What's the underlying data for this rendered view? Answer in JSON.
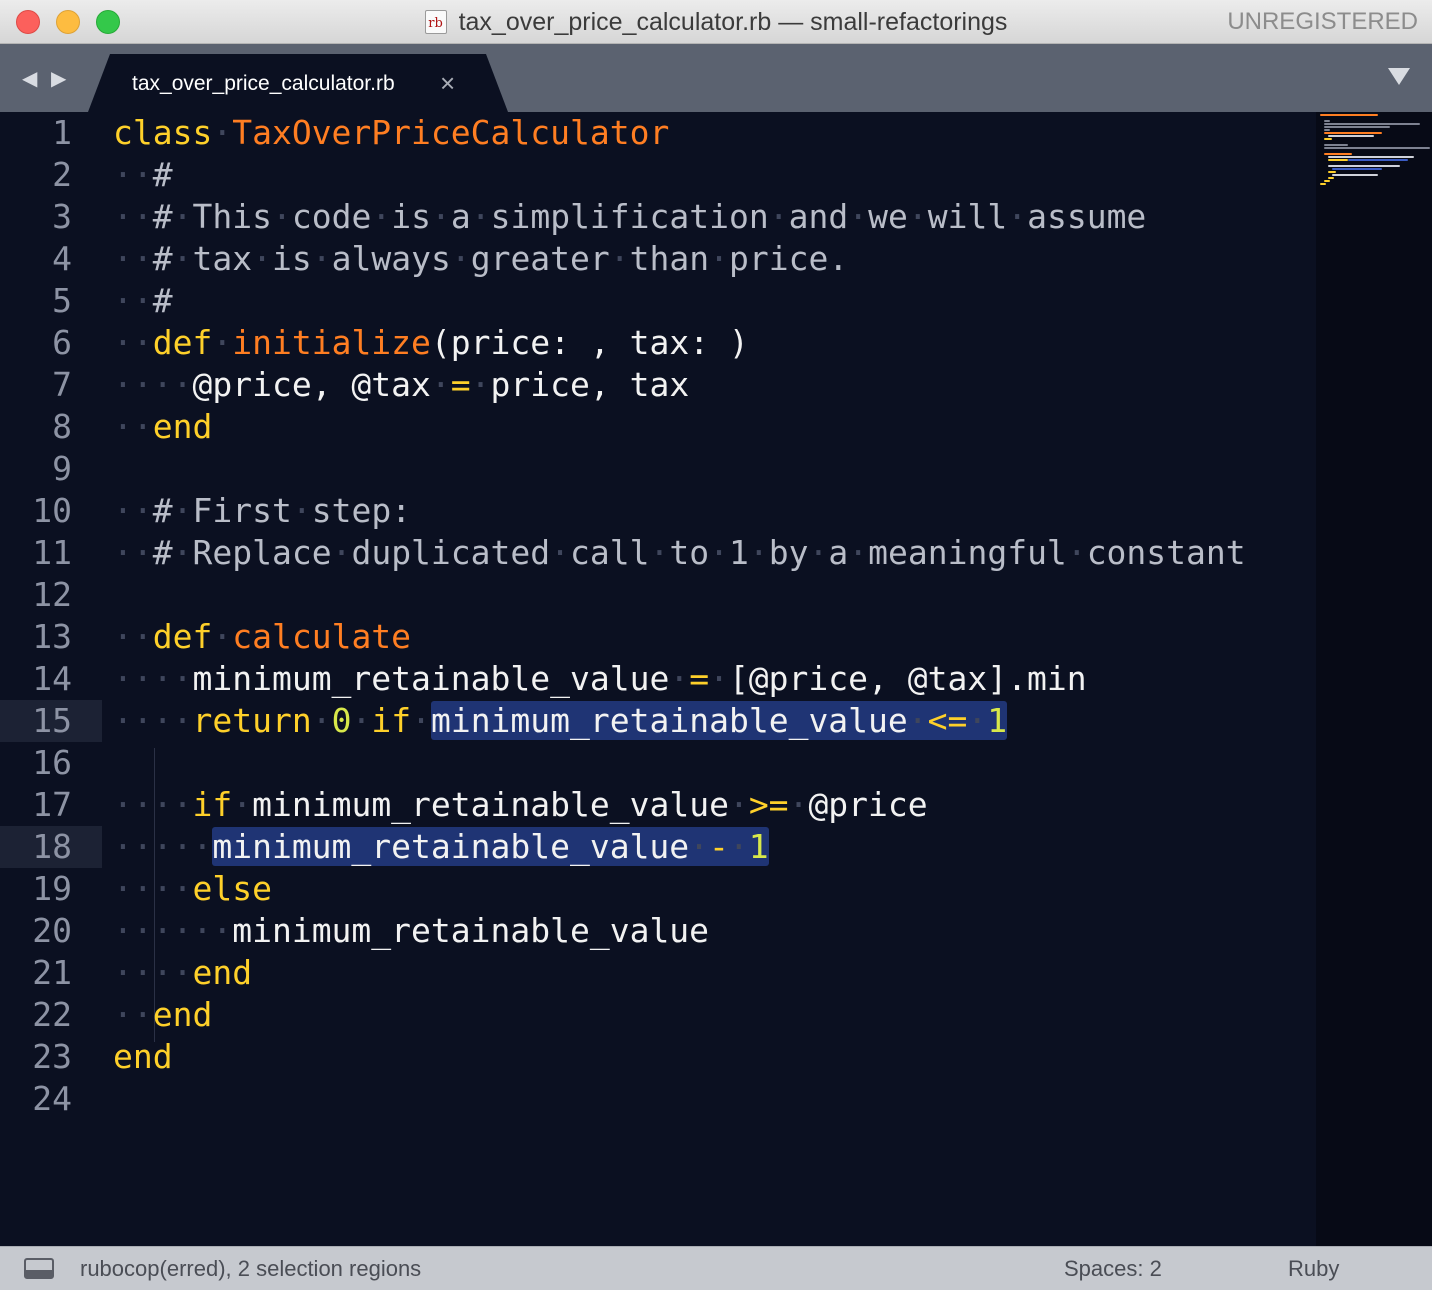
{
  "window": {
    "title": "tax_over_price_calculator.rb — small-refactorings",
    "file_icon_text": "rb",
    "license": "UNREGISTERED"
  },
  "tabs": [
    {
      "label": "tax_over_price_calculator.rb",
      "close": "×",
      "active": true
    }
  ],
  "nav_arrows": "◀ ▶",
  "editor": {
    "language": "ruby",
    "active_lines": [
      15,
      18
    ],
    "selection_count": 2,
    "lines": [
      {
        "n": "1"
      },
      {
        "n": "2"
      },
      {
        "n": "3"
      },
      {
        "n": "4"
      },
      {
        "n": "5"
      },
      {
        "n": "6"
      },
      {
        "n": "7"
      },
      {
        "n": "8"
      },
      {
        "n": "9"
      },
      {
        "n": "10"
      },
      {
        "n": "11"
      },
      {
        "n": "12"
      },
      {
        "n": "13"
      },
      {
        "n": "14"
      },
      {
        "n": "15"
      },
      {
        "n": "16"
      },
      {
        "n": "17"
      },
      {
        "n": "18"
      },
      {
        "n": "19"
      },
      {
        "n": "20"
      },
      {
        "n": "21"
      },
      {
        "n": "22"
      },
      {
        "n": "23"
      },
      {
        "n": "24"
      }
    ],
    "tokens": {
      "l1": {
        "kw": "class",
        "name": "TaxOverPriceCalculator"
      },
      "l2": {
        "comment": "#"
      },
      "l3": {
        "comment": "# This code is a simplification and we will assume"
      },
      "l4": {
        "comment": "# tax is always greater than price."
      },
      "l5": {
        "comment": "#"
      },
      "l6": {
        "kw": "def",
        "name": "initialize",
        "args": "(price: , tax: )"
      },
      "l7": {
        "lhs": "@price, @tax",
        "op": "=",
        "rhs": "price, tax"
      },
      "l8": {
        "kw": "end"
      },
      "l10": {
        "comment": "# First step:"
      },
      "l11": {
        "comment": "# Replace duplicated call to 1 by a meaningful constant"
      },
      "l13": {
        "kw": "def",
        "name": "calculate"
      },
      "l14": {
        "lhs": "minimum_retainable_value",
        "op": "=",
        "rhs": "[@price, @tax].min"
      },
      "l15": {
        "kw": "return",
        "num": "0",
        "kw2": "if",
        "sel_var": "minimum_retainable_value",
        "op": "<=",
        "num2": "1"
      },
      "l17": {
        "kw": "if",
        "var": "minimum_retainable_value",
        "op": ">=",
        "rhs": "@price"
      },
      "l18": {
        "sel_var": "minimum_retainable_value",
        "op": "-",
        "num": "1"
      },
      "l19": {
        "kw": "else"
      },
      "l20": {
        "var": "minimum_retainable_value"
      },
      "l21": {
        "kw": "end"
      },
      "l22": {
        "kw": "end"
      },
      "l23": {
        "kw": "end"
      }
    }
  },
  "colors": {
    "background": "#0b1021",
    "keyword": "#fed02a",
    "class_name": "#ff7e22",
    "comment": "#b9bdc8",
    "number": "#d8e84a",
    "selection": "#1f3474"
  },
  "statusbar": {
    "message": "rubocop(erred), 2 selection regions",
    "indentation": "Spaces: 2",
    "syntax": "Ruby"
  }
}
